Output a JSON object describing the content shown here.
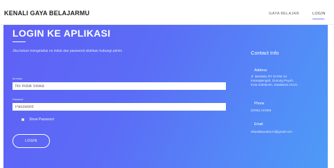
{
  "header": {
    "brand": "KENALI GAYA BELAJARMU",
    "nav": [
      {
        "label": "GAYA BELAJAR"
      },
      {
        "label": "LOGIN"
      }
    ]
  },
  "login": {
    "title": "LOGIN KE APLIKASI",
    "notice": "Jika belum mengetahui no induk dan password silahkan hubungi admin",
    "induk_label": "No Induk",
    "induk_placeholder": "No Induk Siswa",
    "password_label": "Password",
    "password_placeholder": "Password",
    "show_password_label": "Show Password",
    "show_password_checked": false,
    "button_label": "LOGIN"
  },
  "contact": {
    "title": "Contact Info",
    "address_label": "Address",
    "address_lines": [
      "Jl. Merbabu RT 03 RW 10",
      "Karangtengah, Gunung Puyuh,",
      "Kota Sukabumi, Jawabarat 43121"
    ],
    "phone_label": "Phone",
    "phone": "(0266) 123456",
    "email_label": "Email",
    "email": "eliandakusat11mi@gmail.com"
  },
  "colors": {
    "gradient_start": "#5f61f5",
    "gradient_end": "#4d9bf7",
    "nav_active_underline": "#7a7af0"
  }
}
